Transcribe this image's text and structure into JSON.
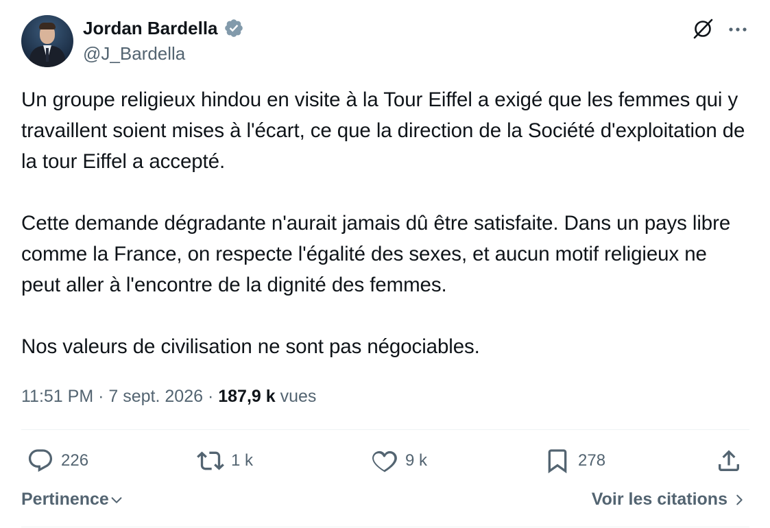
{
  "author": {
    "name": "Jordan Bardella",
    "handle": "@J_Bardella",
    "verified_color": "#829aab"
  },
  "tweet": {
    "paragraphs": [
      "Un groupe religieux hindou en visite à la Tour Eiffel a exigé que les femmes qui y travaillent soient mises à l'écart, ce que la direction de la Société d'exploitation de la tour Eiffel a accepté.",
      "Cette demande dégradante n'aurait jamais dû être satisfaite. Dans un pays libre comme la France, on respecte l'égalité des sexes, et aucun motif religieux ne peut aller à l'encontre de la dignité des femmes.",
      "Nos valeurs de civilisation ne sont pas négociables."
    ],
    "time": "11:51 PM",
    "separator": "·",
    "date": "7 sept. 2026",
    "views_count": "187,9 k",
    "views_label": "vues"
  },
  "actions": {
    "replies": "226",
    "retweets": "1 k",
    "likes": "9 k",
    "bookmarks": "278"
  },
  "footer": {
    "sort_label": "Pertinence",
    "quotes_label": "Voir les citations"
  },
  "icons": {
    "header_right": [
      "grok-icon",
      "more-icon"
    ],
    "actions": [
      "reply-icon",
      "retweet-icon",
      "like-icon",
      "bookmark-icon",
      "share-icon"
    ]
  },
  "colors": {
    "text_primary": "#0f1419",
    "text_secondary": "#536471",
    "divider": "#eff3f4"
  }
}
